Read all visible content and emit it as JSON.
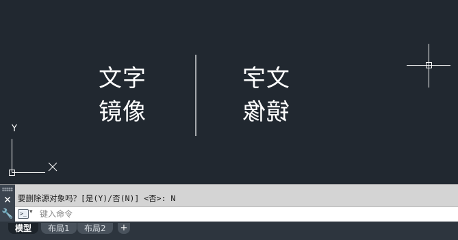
{
  "canvas": {
    "text_original": {
      "line1": "文字",
      "line2": "镜像"
    },
    "text_mirrored": {
      "line1": "文字",
      "line2": "镜像"
    },
    "ucs": {
      "x_label": "X",
      "y_label": "Y"
    }
  },
  "command": {
    "history": "要删除源对象吗？[是(Y)/否(N)] <否>: N",
    "prompt_icon": ">_",
    "input_placeholder": "键入命令",
    "close_icon": "close-icon",
    "customize_icon": "wrench-icon"
  },
  "tabs": [
    {
      "label": "模型",
      "active": true
    },
    {
      "label": "布局1",
      "active": false
    },
    {
      "label": "布局2",
      "active": false
    }
  ],
  "add_tab_label": "+",
  "colors": {
    "canvas_bg": "#212830",
    "text": "#ffffff",
    "command_bg": "#d4d4d4"
  }
}
